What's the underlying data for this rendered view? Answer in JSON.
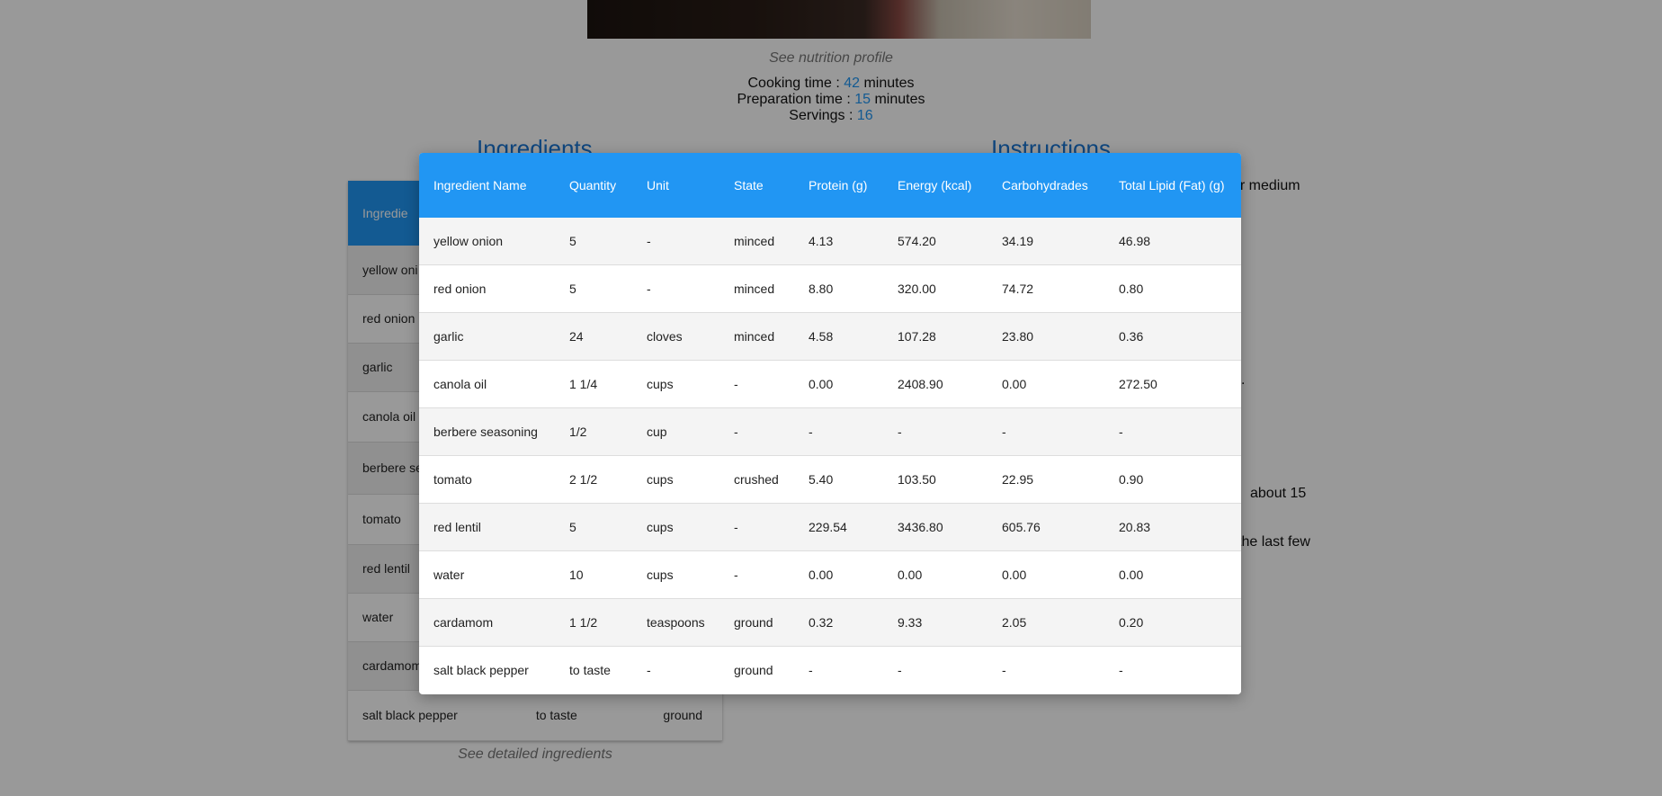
{
  "page": {
    "nutrition_link": "See nutrition profile",
    "cooking": {
      "label": "Cooking time : ",
      "value": "42",
      "unit": " minutes"
    },
    "preparation": {
      "label": "Preparation time : ",
      "value": "15",
      "unit": " minutes"
    },
    "servings": {
      "label": "Servings : ",
      "value": "16"
    },
    "ingredients_title": "Ingredients",
    "instructions_title": "Instructions",
    "detailed_link": "See detailed ingredients",
    "instructions_fragments": [
      "er  medium",
      ".",
      "about  15",
      "the last few"
    ],
    "colors": {
      "accent": "#2196f3",
      "title": "#1976d2",
      "overlay": "rgba(0,0,0,0.4)"
    }
  },
  "background_table": {
    "header_label": "Ingredie",
    "rows": [
      {
        "name": "yellow oni",
        "qty": "",
        "state": ""
      },
      {
        "name": "red onion",
        "qty": "",
        "state": ""
      },
      {
        "name": "garlic",
        "qty": "",
        "state": ""
      },
      {
        "name": "canola oil",
        "qty": "",
        "state": ""
      },
      {
        "name": "berbere se",
        "qty": "",
        "state": ""
      },
      {
        "name": "tomato",
        "qty": "",
        "state": ""
      },
      {
        "name": "red lentil",
        "qty": "",
        "state": ""
      },
      {
        "name": "water",
        "qty": "",
        "state": ""
      },
      {
        "name": "cardamom",
        "qty": "",
        "state": ""
      },
      {
        "name": "salt black pepper",
        "qty": "to taste",
        "state": "ground"
      }
    ]
  },
  "modal": {
    "columns": [
      "Ingredient Name",
      "Quantity",
      "Unit",
      "State",
      "Protein (g)",
      "Energy (kcal)",
      "Carbohydrades",
      "Total Lipid (Fat) (g)"
    ],
    "rows": [
      [
        "yellow onion",
        "5",
        "-",
        "minced",
        "4.13",
        "574.20",
        "34.19",
        "46.98"
      ],
      [
        "red onion",
        "5",
        "-",
        "minced",
        "8.80",
        "320.00",
        "74.72",
        "0.80"
      ],
      [
        "garlic",
        "24",
        "cloves",
        "minced",
        "4.58",
        "107.28",
        "23.80",
        "0.36"
      ],
      [
        "canola oil",
        "1 1/4",
        "cups",
        "-",
        "0.00",
        "2408.90",
        "0.00",
        "272.50"
      ],
      [
        "berbere seasoning",
        "1/2",
        "cup",
        "-",
        "-",
        "-",
        "-",
        "-"
      ],
      [
        "tomato",
        "2 1/2",
        "cups",
        "crushed",
        "5.40",
        "103.50",
        "22.95",
        "0.90"
      ],
      [
        "red lentil",
        "5",
        "cups",
        "-",
        "229.54",
        "3436.80",
        "605.76",
        "20.83"
      ],
      [
        "water",
        "10",
        "cups",
        "-",
        "0.00",
        "0.00",
        "0.00",
        "0.00"
      ],
      [
        "cardamom",
        "1 1/2",
        "teaspoons",
        "ground",
        "0.32",
        "9.33",
        "2.05",
        "0.20"
      ],
      [
        "salt black pepper",
        "to taste",
        "-",
        "ground",
        "-",
        "-",
        "-",
        "-"
      ]
    ]
  }
}
